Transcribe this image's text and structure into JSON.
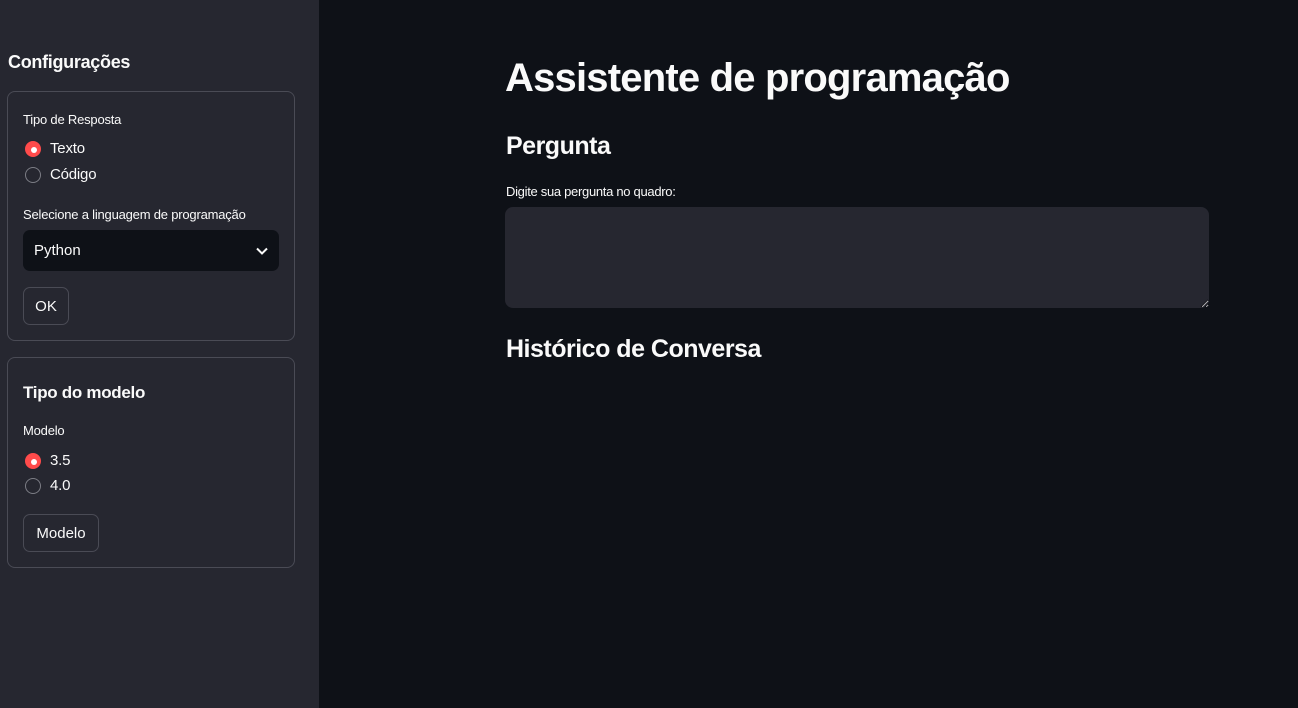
{
  "sidebar": {
    "title": "Configurações",
    "response_box": {
      "label": "Tipo de Resposta",
      "options": [
        "Texto",
        "Código"
      ],
      "selected": "Texto",
      "language_label": "Selecione a linguagem de programação",
      "language_value": "Python",
      "ok_label": "OK"
    },
    "model_box": {
      "title": "Tipo do modelo",
      "label": "Modelo",
      "options": [
        "3.5",
        "4.0"
      ],
      "selected": "3.5",
      "button_label": "Modelo"
    }
  },
  "main": {
    "title": "Assistente de programação",
    "question_heading": "Pergunta",
    "question_label": "Digite sua pergunta no quadro:",
    "question_value": "",
    "history_heading": "Histórico de Conversa"
  },
  "colors": {
    "accent": "#ff4b4b",
    "sidebar_bg": "#262730",
    "main_bg": "#0e1117"
  }
}
